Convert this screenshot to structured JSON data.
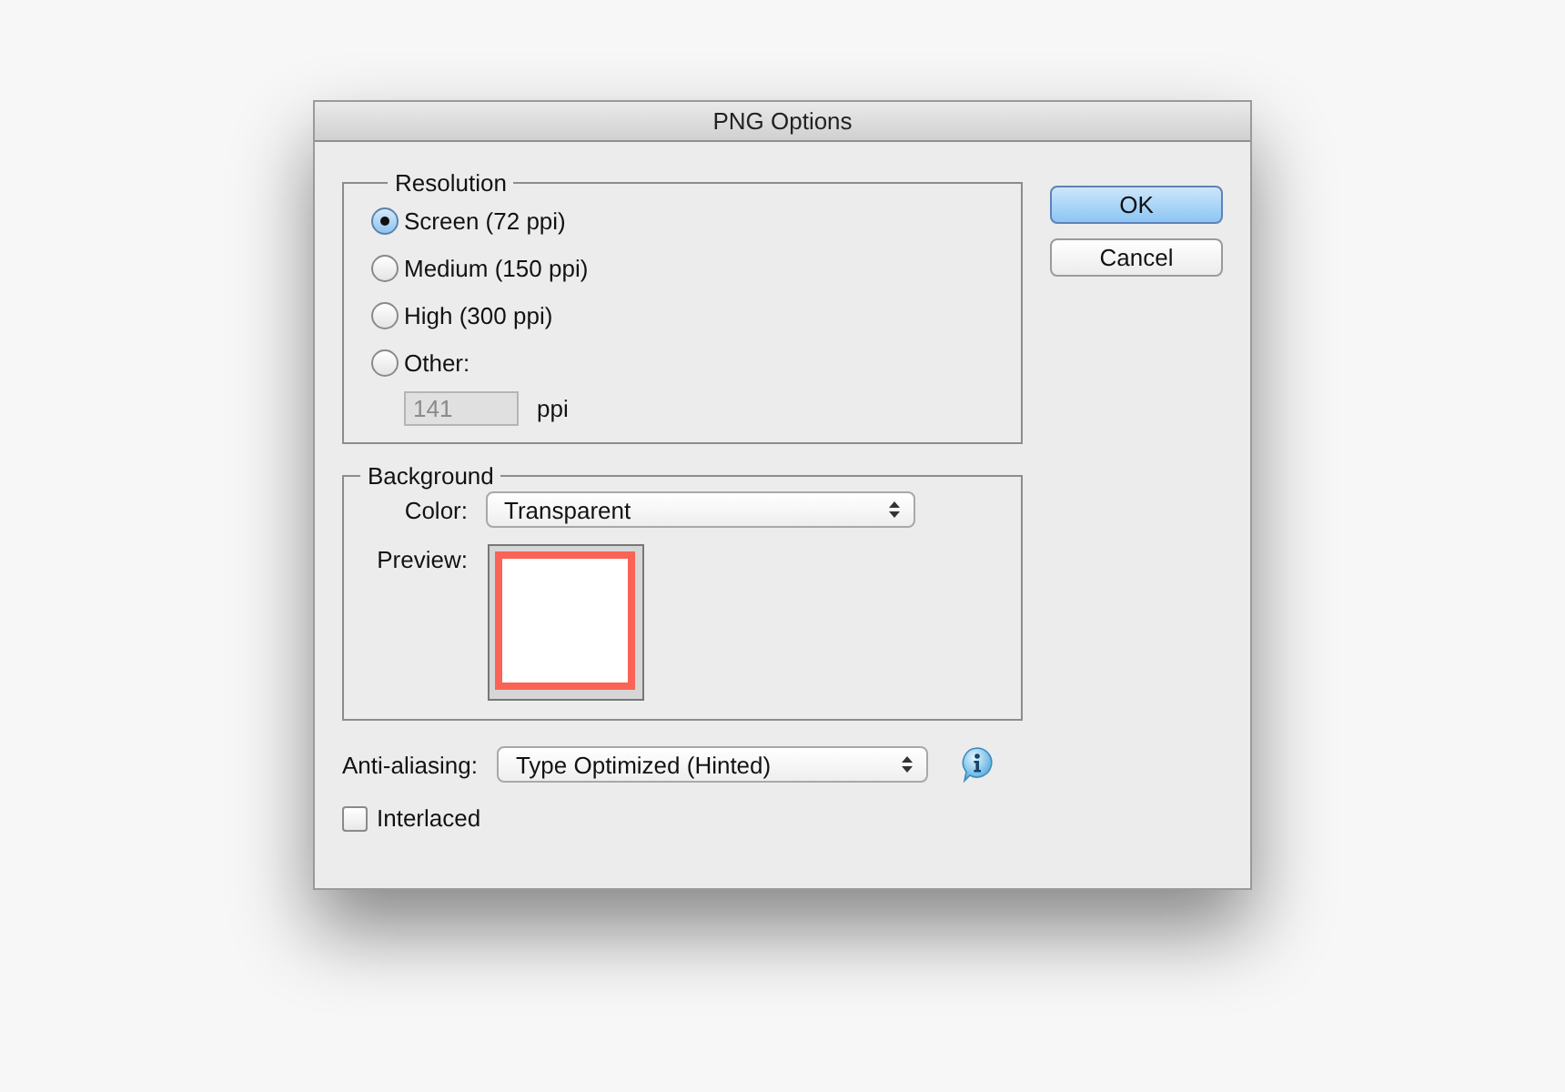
{
  "window": {
    "title": "PNG Options"
  },
  "resolution": {
    "legend": "Resolution",
    "options": [
      {
        "label": "Screen (72 ppi)",
        "selected": true
      },
      {
        "label": "Medium (150 ppi)",
        "selected": false
      },
      {
        "label": "High (300 ppi)",
        "selected": false
      },
      {
        "label": "Other:",
        "selected": false
      }
    ],
    "other_field": {
      "value": "141",
      "disabled": true
    },
    "unit": "ppi"
  },
  "background": {
    "legend": "Background",
    "color_label": "Color:",
    "color_value": "Transparent",
    "preview_label": "Preview:"
  },
  "anti_aliasing": {
    "label": "Anti-aliasing:",
    "value": "Type Optimized (Hinted)"
  },
  "interlaced": {
    "label": "Interlaced",
    "checked": false
  },
  "buttons": [
    {
      "label": "OK",
      "default": true
    },
    {
      "label": "Cancel",
      "default": false
    }
  ]
}
